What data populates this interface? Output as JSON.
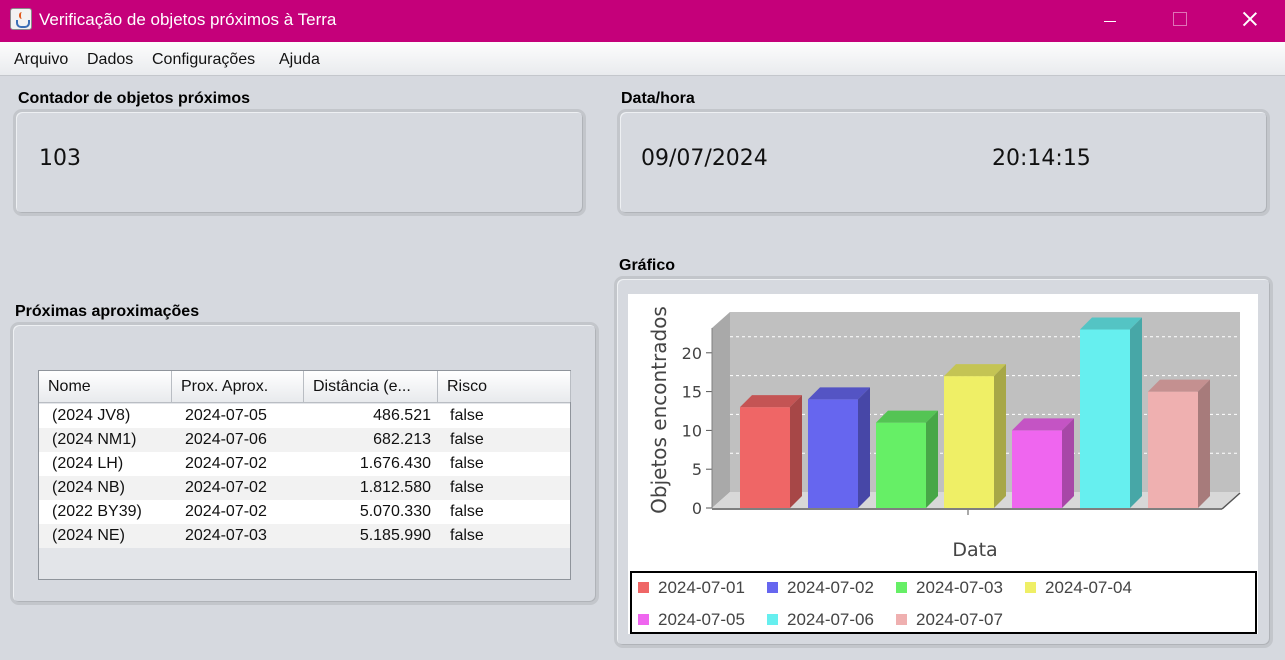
{
  "window": {
    "title": "Verificação de objetos próximos à Terra",
    "icon": "java-icon"
  },
  "menu": [
    "Arquivo",
    "Dados",
    "Configurações",
    "Ajuda"
  ],
  "counter": {
    "label": "Contador de objetos próximos",
    "value": "103"
  },
  "datetime": {
    "label": "Data/hora",
    "date": "09/07/2024",
    "time": "20:14:15"
  },
  "approaches": {
    "label": "Próximas aproximações",
    "columns": [
      "Nome",
      "Prox. Aprox.",
      "Distância (e...",
      "Risco"
    ],
    "rows": [
      [
        "(2024 JV8)",
        "2024-07-05",
        "486.521",
        "false"
      ],
      [
        "(2024 NM1)",
        "2024-07-06",
        "682.213",
        "false"
      ],
      [
        "(2024 LH)",
        "2024-07-02",
        "1.676.430",
        "false"
      ],
      [
        "(2024 NB)",
        "2024-07-02",
        "1.812.580",
        "false"
      ],
      [
        "(2022 BY39)",
        "2024-07-02",
        "5.070.330",
        "false"
      ],
      [
        "(2024 NE)",
        "2024-07-03",
        "5.185.990",
        "false"
      ]
    ]
  },
  "chart_panel": {
    "label": "Gráfico"
  },
  "chart_data": {
    "type": "bar",
    "xlabel": "Data",
    "ylabel": "Objetos encontrados",
    "ylim": [
      0,
      25
    ],
    "yticks": [
      "0",
      "5",
      "10",
      "15",
      "20"
    ],
    "grid": true,
    "legend_position": "bottom",
    "series": [
      {
        "name": "2024-07-01",
        "value": 13,
        "color": "#ef6666"
      },
      {
        "name": "2024-07-02",
        "value": 14,
        "color": "#6666ef"
      },
      {
        "name": "2024-07-03",
        "value": 11,
        "color": "#66ef66"
      },
      {
        "name": "2024-07-04",
        "value": 17,
        "color": "#efef66"
      },
      {
        "name": "2024-07-05",
        "value": 10,
        "color": "#ef66ef"
      },
      {
        "name": "2024-07-06",
        "value": 23,
        "color": "#66efef"
      },
      {
        "name": "2024-07-07",
        "value": 15,
        "color": "#efb0b0"
      }
    ]
  }
}
